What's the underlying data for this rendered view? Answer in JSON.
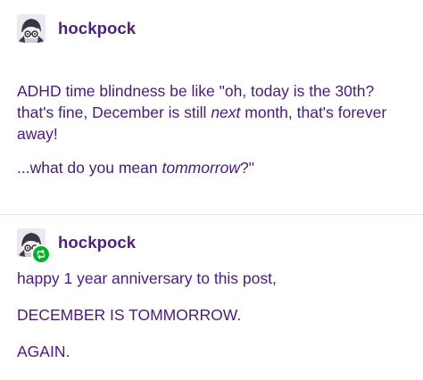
{
  "posts": [
    {
      "author": "hockpock",
      "paragraphs": {
        "p1_before": "ADHD time blindness be like \"oh, today is the 30th? that's fine, December is still ",
        "p1_italic": "next",
        "p1_after": " month, that's forever away!",
        "p2_before": "...what do you mean ",
        "p2_italic": "tommorrow",
        "p2_after": "?\""
      }
    },
    {
      "author": "hockpock",
      "reblog_icon": "reblog-icon",
      "paragraphs": [
        "happy 1 year anniversary to this post,",
        "DECEMBER IS TOMMORROW.",
        "AGAIN."
      ]
    }
  ],
  "colors": {
    "text": "#4a1a78",
    "username": "#4f1f7a",
    "reblog_badge": "#00b22a",
    "divider": "#e6e3ea"
  }
}
